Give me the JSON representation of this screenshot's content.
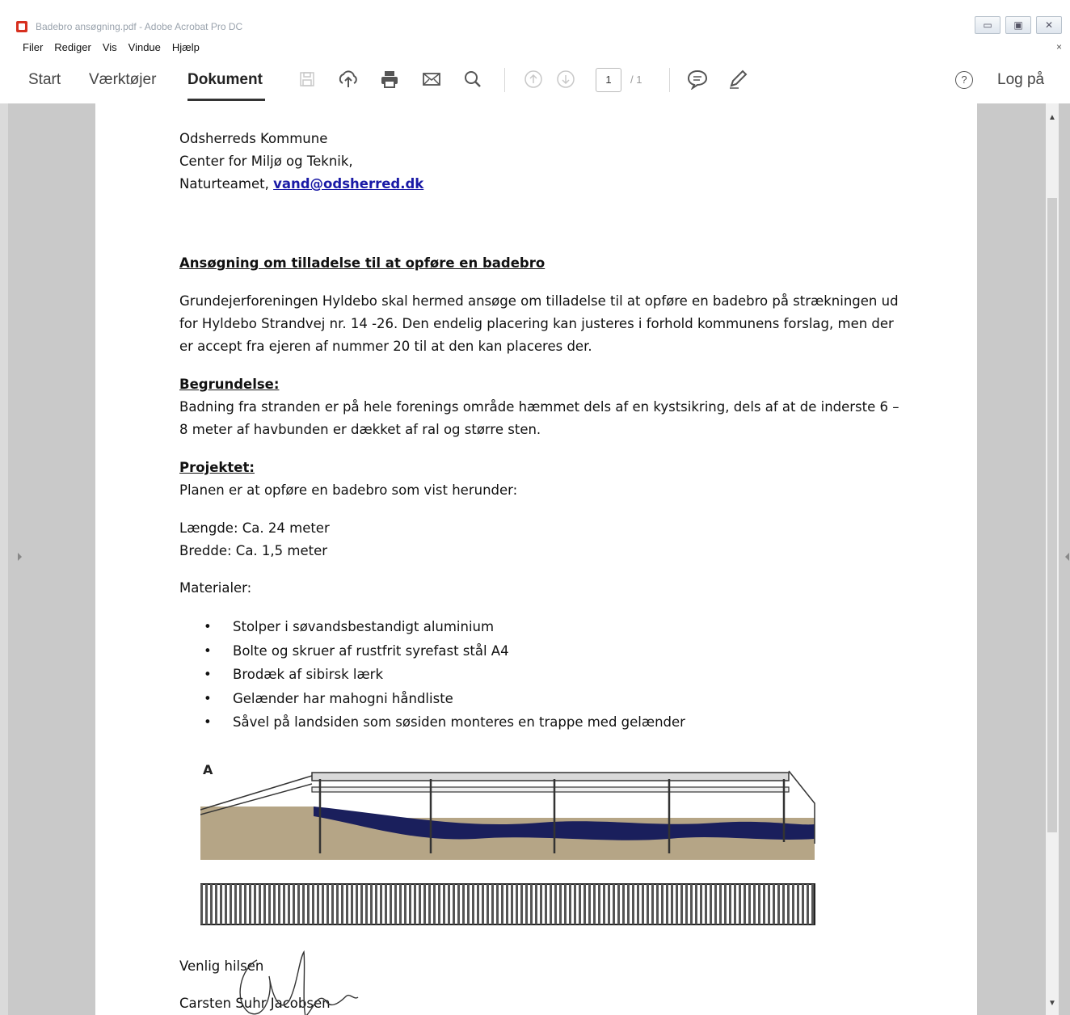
{
  "window": {
    "title": "Badebro ansøgning.pdf - Adobe Acrobat Pro DC"
  },
  "menu": {
    "items": [
      "Filer",
      "Rediger",
      "Vis",
      "Vindue",
      "Hjælp"
    ],
    "close": "×"
  },
  "toolbar": {
    "tabs": [
      "Start",
      "Værktøjer",
      "Dokument"
    ],
    "active_tab": "Dokument",
    "page_current": "1",
    "page_total": "/ 1",
    "help": "?",
    "login": "Log på",
    "icons": [
      "save-icon",
      "upload-icon",
      "print-icon",
      "mail-icon",
      "search-icon",
      "page-up-icon",
      "page-down-icon",
      "comment-icon",
      "pen-icon"
    ]
  },
  "document": {
    "address": {
      "line1": "Odsherreds Kommune",
      "line2": "Center for Miljø og Teknik,",
      "line3_prefix": "Naturteamet, ",
      "email": "vand@odsherred.dk"
    },
    "heading": "Ansøgning om tilladelse til at opføre en badebro",
    "intro_lines": [
      "Grundejerforeningen Hyldebo skal hermed ansøge om tilladelse til at opføre en badebro på strækningen ud",
      "for Hyldebo Strandvej nr. 14 -26. Den endelig placering kan justeres i forhold kommunens forslag, men der",
      "er accept fra ejeren af nummer 20 til at den kan placeres der."
    ],
    "begrundelse_title": "Begrundelse:",
    "begrundelse_lines": [
      "Badning fra stranden er på hele forenings område hæmmet dels af en kystsikring, dels af at de inderste 6 –",
      "8 meter af havbunden er dækket af ral og større sten."
    ],
    "projekt_title": "Projektet:",
    "projekt_text": "Planen er at opføre en badebro som vist herunder:",
    "laengde": "Længde: Ca. 24 meter",
    "bredde": "Bredde: Ca. 1,5 meter",
    "materialer_title": "Materialer:",
    "materialer": [
      "Stolper i søvandsbestandigt aluminium",
      "Bolte og skruer af rustfrit syrefast stål A4",
      "Brodæk af sibirsk lærk",
      "Gelænder har mahogni håndliste",
      "Såvel på landsiden som søsiden monteres en trappe med gelænder"
    ],
    "drawing_label": "A",
    "closing": "Venlig hilsen",
    "signer": "Carsten Suhr Jacobsen"
  },
  "colors": {
    "link": "#1a1aa6",
    "water": "#1a1f5c",
    "sand": "#b7a88c",
    "pdf_red": "#d7301f"
  }
}
